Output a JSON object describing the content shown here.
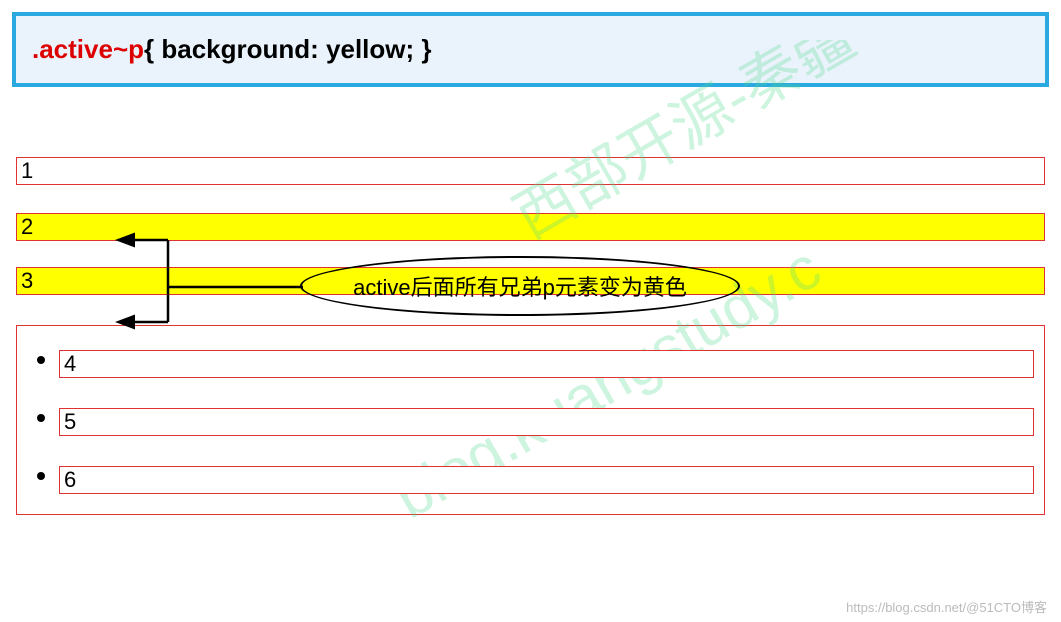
{
  "code": {
    "selector": ".active~p",
    "rest": "{  background: yellow;  }"
  },
  "items": {
    "p1": "1",
    "p2": "2",
    "p3": "3",
    "li4": "4",
    "li5": "5",
    "li6": "6"
  },
  "annotation": "active后面所有兄弟p元素变为黄色",
  "watermark_bg_line1": "西部开源-秦疆",
  "watermark_bg_line2": "blog.kuangstudy.c",
  "watermark_footer": "https://blog.csdn.net/@51CTO博客"
}
